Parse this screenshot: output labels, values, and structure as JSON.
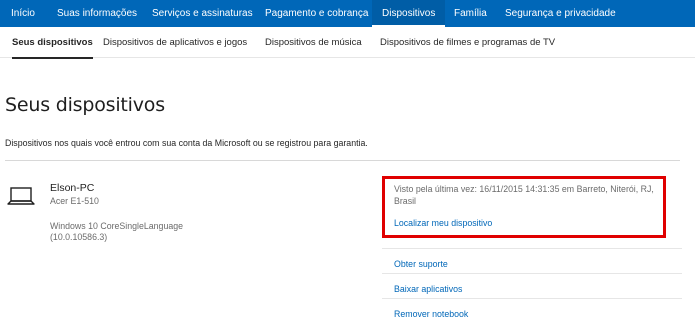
{
  "topnav": {
    "tabs": [
      {
        "label": "Início"
      },
      {
        "label": "Suas informações"
      },
      {
        "label": "Serviços e assinaturas"
      },
      {
        "label": "Pagamento e cobrança"
      },
      {
        "label": "Dispositivos",
        "active": true
      },
      {
        "label": "Família"
      },
      {
        "label": "Segurança e privacidade"
      }
    ]
  },
  "subnav": {
    "tabs": [
      {
        "label": "Seus dispositivos",
        "active": true
      },
      {
        "label": "Dispositivos de aplicativos e jogos"
      },
      {
        "label": "Dispositivos de música"
      },
      {
        "label": "Dispositivos de filmes e programas de TV"
      }
    ]
  },
  "page": {
    "title": "Seus dispositivos",
    "description": "Dispositivos nos quais você entrou com sua conta da Microsoft ou se registrou para garantia."
  },
  "device": {
    "icon": "laptop-icon",
    "name": "Elson-PC",
    "model": "Acer E1-510",
    "os": "Windows 10 CoreSingleLanguage",
    "build": "(10.0.10586.3)",
    "last_seen": "Visto pela última vez: 16/11/2015 14:31:35 em Barreto, Niterói, RJ, Brasil",
    "links": {
      "locate": "Localizar meu dispositivo",
      "support": "Obter suporte",
      "apps": "Baixar aplicativos",
      "remove": "Remover notebook"
    }
  },
  "colors": {
    "accent": "#0067b8",
    "highlight": "#e00000"
  }
}
